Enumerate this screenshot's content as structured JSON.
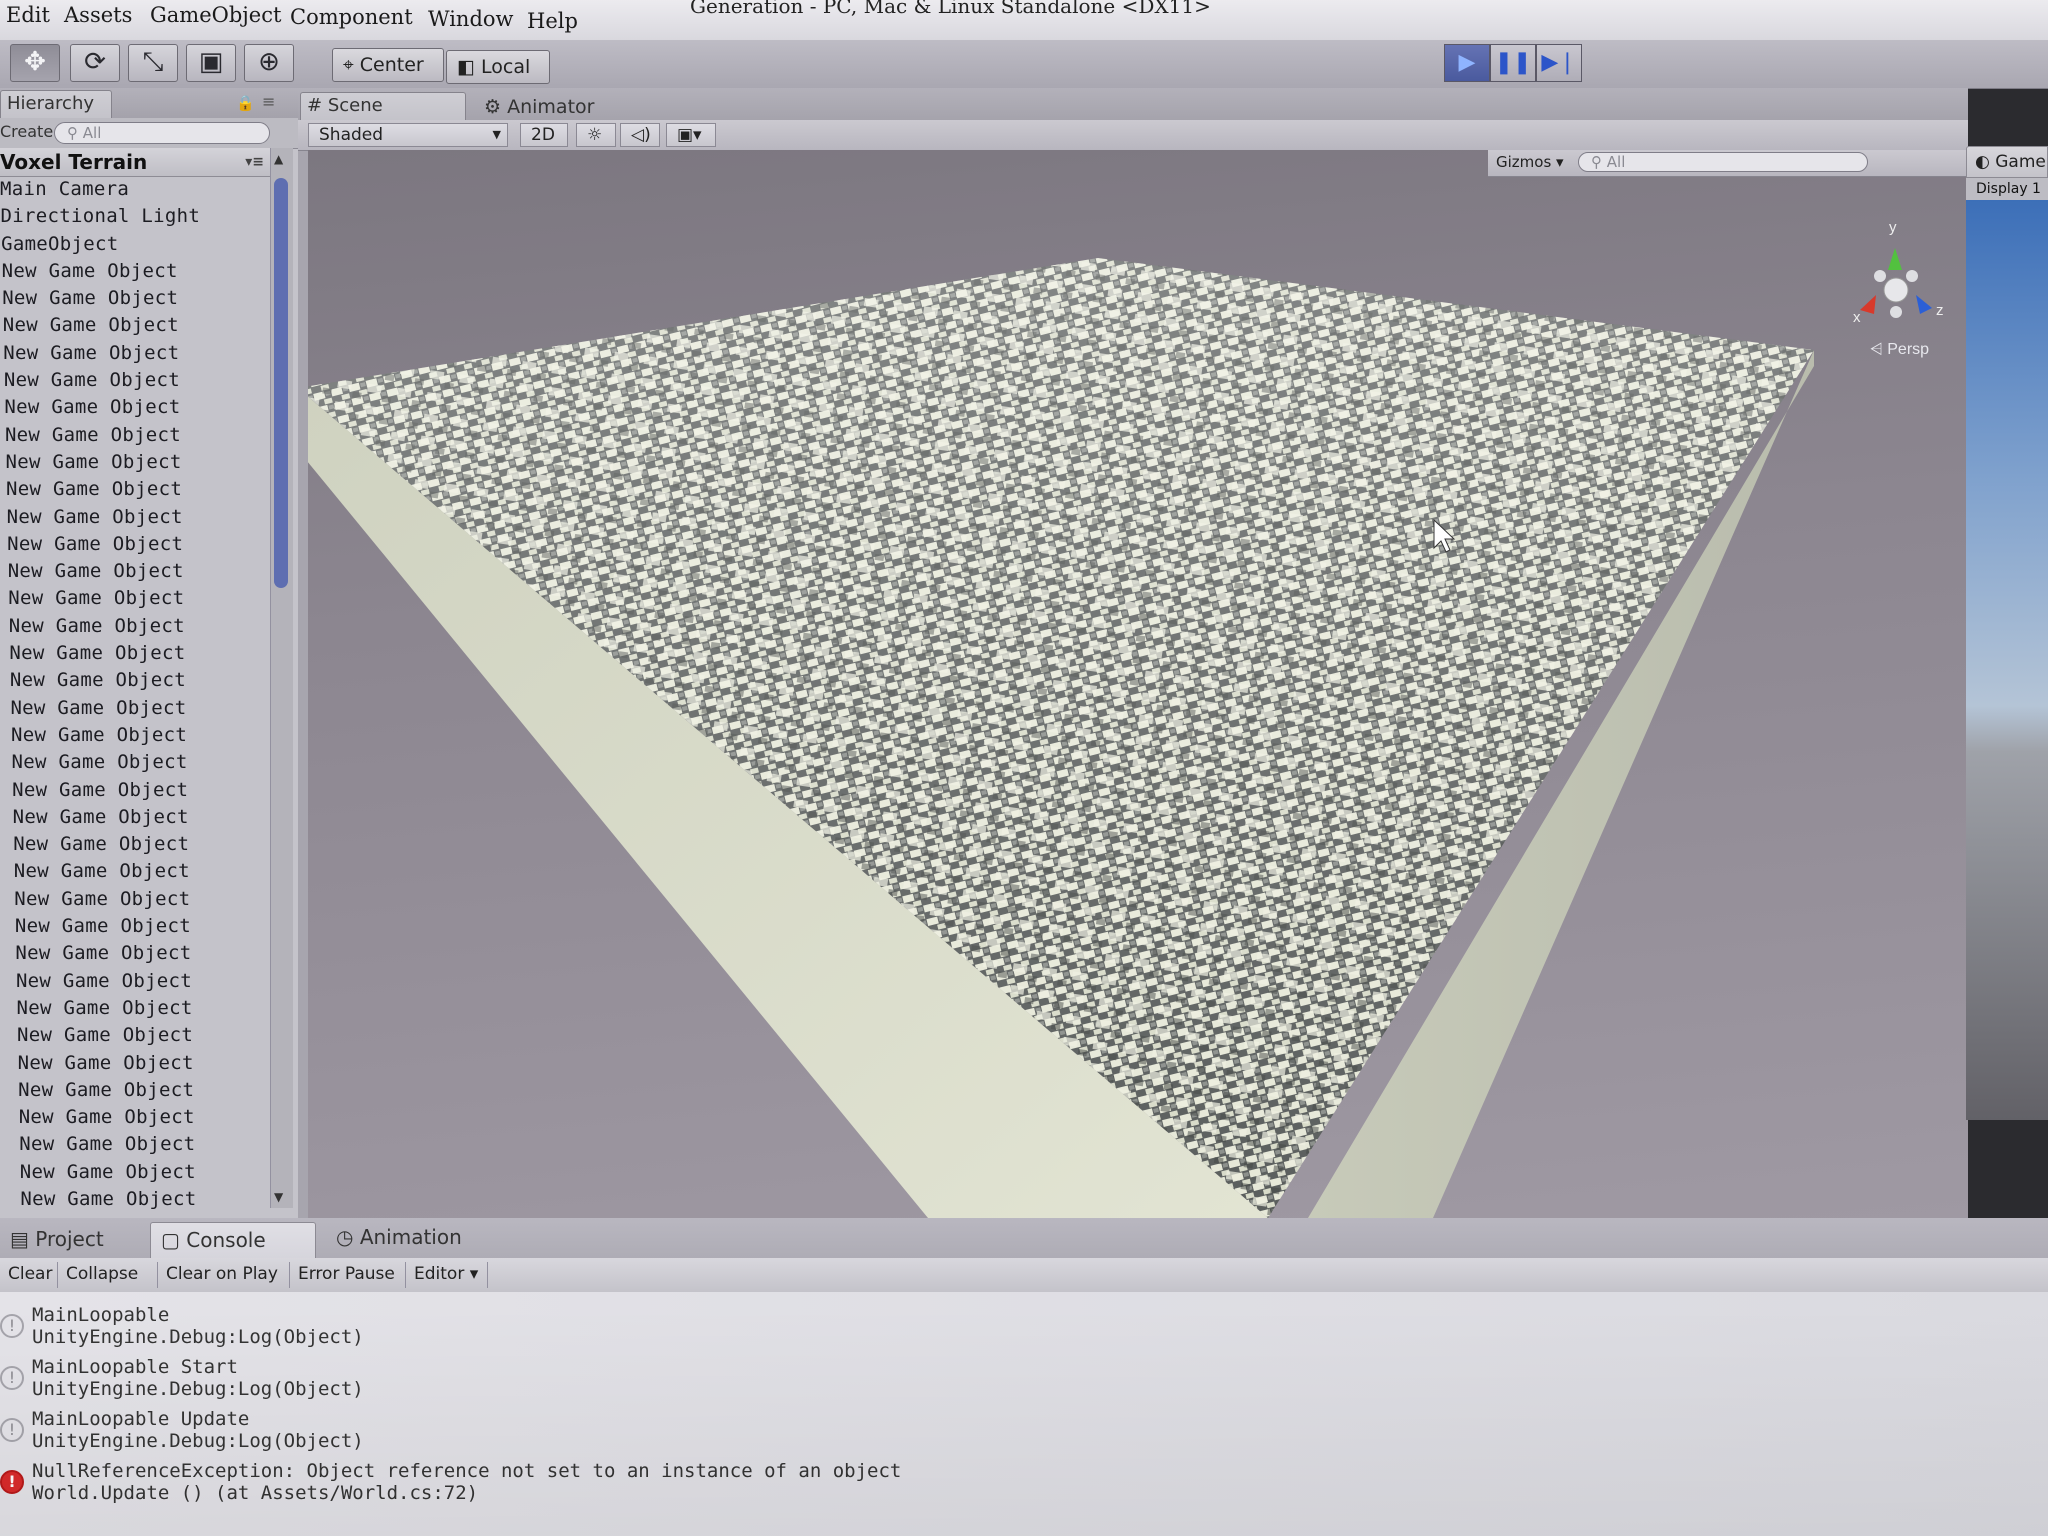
{
  "window": {
    "title": "Generation - PC, Mac & Linux Standalone <DX11>"
  },
  "menu": [
    "Edit",
    "Assets",
    "GameObject",
    "Component",
    "Window",
    "Help"
  ],
  "toolbar": {
    "tools": [
      "move-tool",
      "rotate-tool",
      "scale-tool",
      "rect-tool",
      "transform-tool"
    ],
    "pivot": "Center",
    "space": "Local",
    "play_state": "playing"
  },
  "hierarchy": {
    "tab": "Hierarchy",
    "create_label": "Create",
    "search_placeholder": "All",
    "scene_name": "Voxel Terrain",
    "items": [
      "Main Camera",
      "Directional Light",
      "GameObject",
      "New Game Object",
      "New Game Object",
      "New Game Object",
      "New Game Object",
      "New Game Object",
      "New Game Object",
      "New Game Object",
      "New Game Object",
      "New Game Object",
      "New Game Object",
      "New Game Object",
      "New Game Object",
      "New Game Object",
      "New Game Object",
      "New Game Object",
      "New Game Object",
      "New Game Object",
      "New Game Object",
      "New Game Object",
      "New Game Object",
      "New Game Object",
      "New Game Object",
      "New Game Object",
      "New Game Object",
      "New Game Object",
      "New Game Object",
      "New Game Object",
      "New Game Object",
      "New Game Object",
      "New Game Object",
      "New Game Object",
      "New Game Object",
      "New Game Object",
      "New Game Object",
      "New Game Object"
    ]
  },
  "scene": {
    "tabs": [
      "Scene",
      "Animator"
    ],
    "shading": "Shaded",
    "mode_2d": "2D",
    "gizmos": "Gizmos",
    "search_placeholder": "All",
    "projection": "Persp",
    "axes": {
      "x": "x",
      "y": "y",
      "z": "z"
    }
  },
  "game": {
    "tab": "Game",
    "display": "Display 1"
  },
  "bottom": {
    "tabs": [
      "Project",
      "Console",
      "Animation"
    ],
    "console_buttons": [
      "Clear",
      "Collapse",
      "Clear on Play",
      "Error Pause",
      "Editor"
    ],
    "logs": [
      {
        "type": "info",
        "line1": "MainLoopable",
        "line2": "UnityEngine.Debug:Log(Object)"
      },
      {
        "type": "info",
        "line1": "MainLoopable Start",
        "line2": "UnityEngine.Debug:Log(Object)"
      },
      {
        "type": "info",
        "line1": "MainLoopable Update",
        "line2": "UnityEngine.Debug:Log(Object)"
      },
      {
        "type": "error",
        "line1": "NullReferenceException: Object reference not set to an instance of an object",
        "line2": "World.Update () (at Assets/World.cs:72)"
      }
    ]
  },
  "colors": {
    "play_active": "#4a5a9e",
    "error": "#d92b2b",
    "terrain_top": "#e4e6d6",
    "terrain_shadow": "#5c5f5e"
  }
}
